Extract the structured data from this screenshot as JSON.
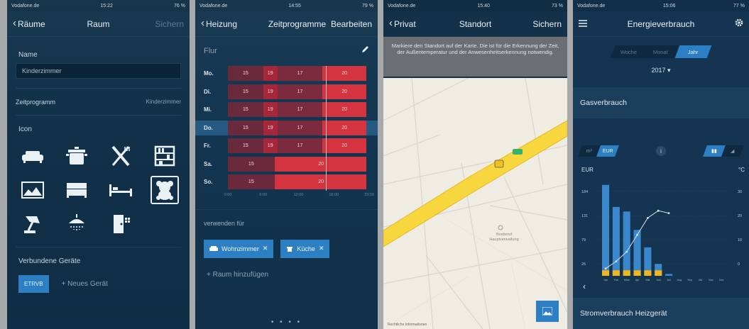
{
  "screen1": {
    "status": {
      "carrier": "Vodafone.de",
      "time": "15:22",
      "battery": "76 %"
    },
    "nav": {
      "back": "Räume",
      "title": "Raum",
      "save": "Sichern"
    },
    "name_label": "Name",
    "name_value": "Kinderzimmer",
    "schedule_label": "Zeitprogramm",
    "schedule_value": "Kinderzimmer",
    "icon_label": "Icon",
    "devices_label": "Verbundene Geräte",
    "device_button": "ETRVB",
    "add_device": "+ Neues Gerät"
  },
  "screen2": {
    "status": {
      "carrier": "Vodafone.de",
      "time": "14:55",
      "battery": "79 %"
    },
    "nav": {
      "back": "Heizung",
      "title": "Zeitprogramme",
      "edit": "Bearbeiten"
    },
    "zone": "Flur",
    "days": [
      "Mo.",
      "Di.",
      "Mi.",
      "Do.",
      "Fr.",
      "Sa.",
      "So."
    ],
    "weekday_temps": [
      "15",
      "19",
      "17",
      "20"
    ],
    "weekend_temps": [
      "15",
      "20"
    ],
    "axis": [
      "0:00",
      "6:00",
      "12:00",
      "18:00",
      "23:59"
    ],
    "use_for_label": "verwenden für",
    "chips": [
      "Wohnzimmer",
      "Küche"
    ],
    "add_room": "+ Raum hinzufügen",
    "page_dots": "• • • •"
  },
  "screen3": {
    "status": {
      "carrier": "Vodafone.de",
      "time": "15:40",
      "battery": "73 %"
    },
    "nav": {
      "back": "Privat",
      "title": "Standort",
      "save": "Sichern"
    },
    "banner": "Markiere den Standort auf der Karte. Die ist für die Erkennung der Zeit, der Außentemperatur und der Anwesenheitserkennung notwendig.",
    "map_place": "Bosberuf Hauptverwaltung",
    "map_legal": "Rechtliche Informationen",
    "colors": {
      "road": "#f7d63e",
      "map_bg": "#efece4"
    }
  },
  "screen4": {
    "status": {
      "carrier": "Vodafone.de",
      "time": "15:06",
      "battery": "77 %"
    },
    "nav": {
      "title": "Energieverbrauch"
    },
    "periods": [
      "Woche",
      "Monat",
      "Jahr"
    ],
    "active_period": "Jahr",
    "year": "2017 ▾",
    "gas_title": "Gasverbrauch",
    "unit_options": [
      "m³",
      "EUR"
    ],
    "active_unit": "EUR",
    "chart_data": {
      "type": "bar",
      "ylabel": "EUR",
      "y2label": "°C",
      "categories": [
        "Jan",
        "Feb",
        "März",
        "Apr",
        "Mai",
        "Juni",
        "Juli",
        "Aug",
        "Sep",
        "Okt",
        "Nov",
        "Dez"
      ],
      "y_ticks": [
        26,
        79,
        131,
        184
      ],
      "y2_ticks": [
        0,
        10,
        20,
        30
      ],
      "ylim": [
        0,
        210
      ],
      "series": [
        {
          "values": [
            198,
            150,
            140,
            100,
            62,
            26,
            4,
            0,
            0,
            0,
            0,
            0
          ]
        },
        {
          "values": [
            12,
            12,
            12,
            12,
            12,
            12,
            0,
            0,
            0,
            0,
            0,
            0
          ]
        },
        {
          "values": [
            -2,
            1,
            5,
            12,
            19,
            22,
            21,
            null,
            null,
            null,
            null,
            null
          ]
        }
      ]
    },
    "electric_title": "Stromverbrauch Heizgerät",
    "colors": {
      "bar": "#3b87cc",
      "bar_base": "#f2b51b",
      "line": "#d8dfe6"
    }
  }
}
